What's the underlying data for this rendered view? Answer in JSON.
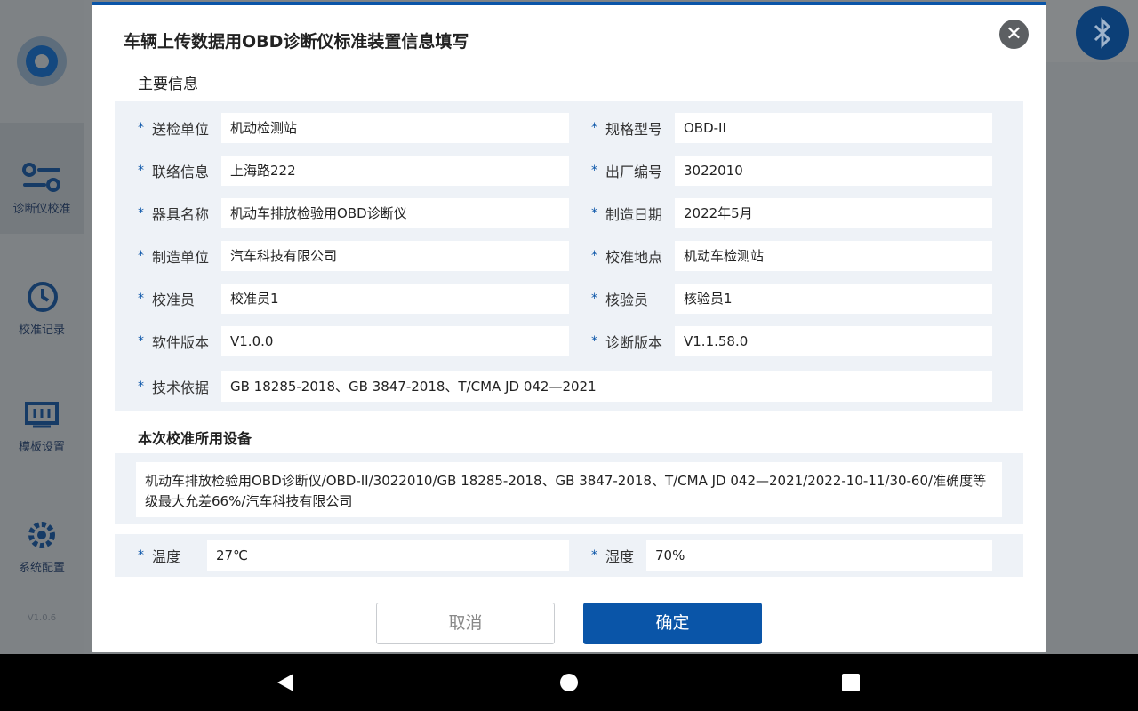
{
  "sidebar": {
    "items": [
      {
        "label": "诊断仪校准",
        "icon": "sliders-icon"
      },
      {
        "label": "校准记录",
        "icon": "history-icon"
      },
      {
        "label": "模板设置",
        "icon": "template-icon"
      },
      {
        "label": "系统配置",
        "icon": "gear-icon"
      }
    ],
    "version": "V1.0.6"
  },
  "modal": {
    "title": "车辆上传数据用OBD诊断仪标准装置信息填写",
    "section_main": "主要信息",
    "fields": {
      "sender_label": "送检单位",
      "sender_value": "机动检测站",
      "model_label": "规格型号",
      "model_value": "OBD-II",
      "contact_label": "联络信息",
      "contact_value": "上海路222",
      "serial_label": "出厂编号",
      "serial_value": "3022010",
      "device_name_label": "器具名称",
      "device_name_value": "机动车排放检验用OBD诊断仪",
      "mfg_date_label": "制造日期",
      "mfg_date_value": "2022年5月",
      "manufacturer_label": "制造单位",
      "manufacturer_value": "汽车科技有限公司",
      "location_label": "校准地点",
      "location_value": "机动车检测站",
      "calibrator_label": "校准员",
      "calibrator_value": "校准员1",
      "verifier_label": "核验员",
      "verifier_value": "核验员1",
      "software_label": "软件版本",
      "software_value": "V1.0.0",
      "diag_version_label": "诊断版本",
      "diag_version_value": "V1.1.58.0",
      "basis_label": "技术依据",
      "basis_value": "GB 18285-2018、GB 3847-2018、T/CMA JD 042—2021"
    },
    "section_equipment": "本次校准所用设备",
    "equipment_text": "机动车排放检验用OBD诊断仪/OBD-II/3022010/GB 18285-2018、GB 3847-2018、T/CMA JD 042—2021/2022-10-11/30-60/准确度等级最大允差66%/汽车科技有限公司",
    "env": {
      "temp_label": "温度",
      "temp_value": "27℃",
      "humidity_label": "湿度",
      "humidity_value": "70%"
    },
    "cancel_label": "取消",
    "confirm_label": "确定",
    "close_glyph": "✕",
    "required_mark": "*"
  },
  "colors": {
    "accent": "#0a55a8",
    "panel": "#eef2f7"
  }
}
